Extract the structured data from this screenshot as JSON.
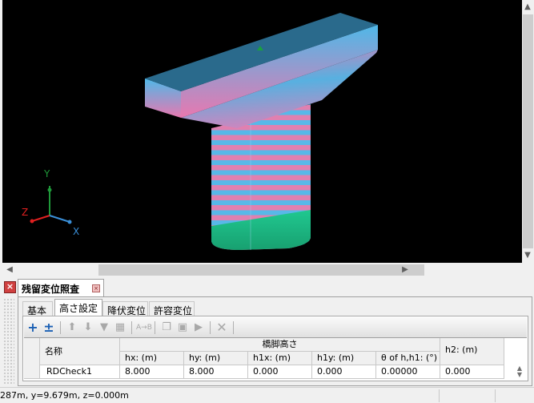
{
  "viewport": {
    "axes": {
      "x": "X",
      "y": "Y",
      "z": "Z"
    },
    "colors": {
      "x_axis": "#3a8fd8",
      "y_axis": "#1f9a3a",
      "z_axis": "#e02020",
      "background": "#000000"
    }
  },
  "panel": {
    "title": "残留変位照査",
    "tabs": [
      {
        "label": "基本",
        "active": false
      },
      {
        "label": "高さ設定",
        "active": true
      },
      {
        "label": "降伏変位",
        "active": false
      },
      {
        "label": "許容変位",
        "active": false
      }
    ],
    "toolbar": [
      "add-icon",
      "insert-icon",
      "move-up-icon",
      "move-down-icon",
      "filter-icon",
      "grid-icon",
      "rename-icon",
      "copy-icon",
      "paste-icon",
      "export-icon",
      "delete-icon"
    ],
    "table": {
      "name_header": "名称",
      "group_header": "橋脚高さ",
      "columns": [
        "hx: (m)",
        "hy: (m)",
        "h1x: (m)",
        "h1y: (m)",
        "θ of h,h1: (°)",
        "h2: (m)"
      ],
      "rows": [
        {
          "name": "RDCheck1",
          "values": [
            "8.000",
            "8.000",
            "0.000",
            "0.000",
            "0.00000",
            "0.000"
          ]
        }
      ]
    }
  },
  "status": {
    "coords": "287m, y=9.679m, z=0.000m"
  }
}
